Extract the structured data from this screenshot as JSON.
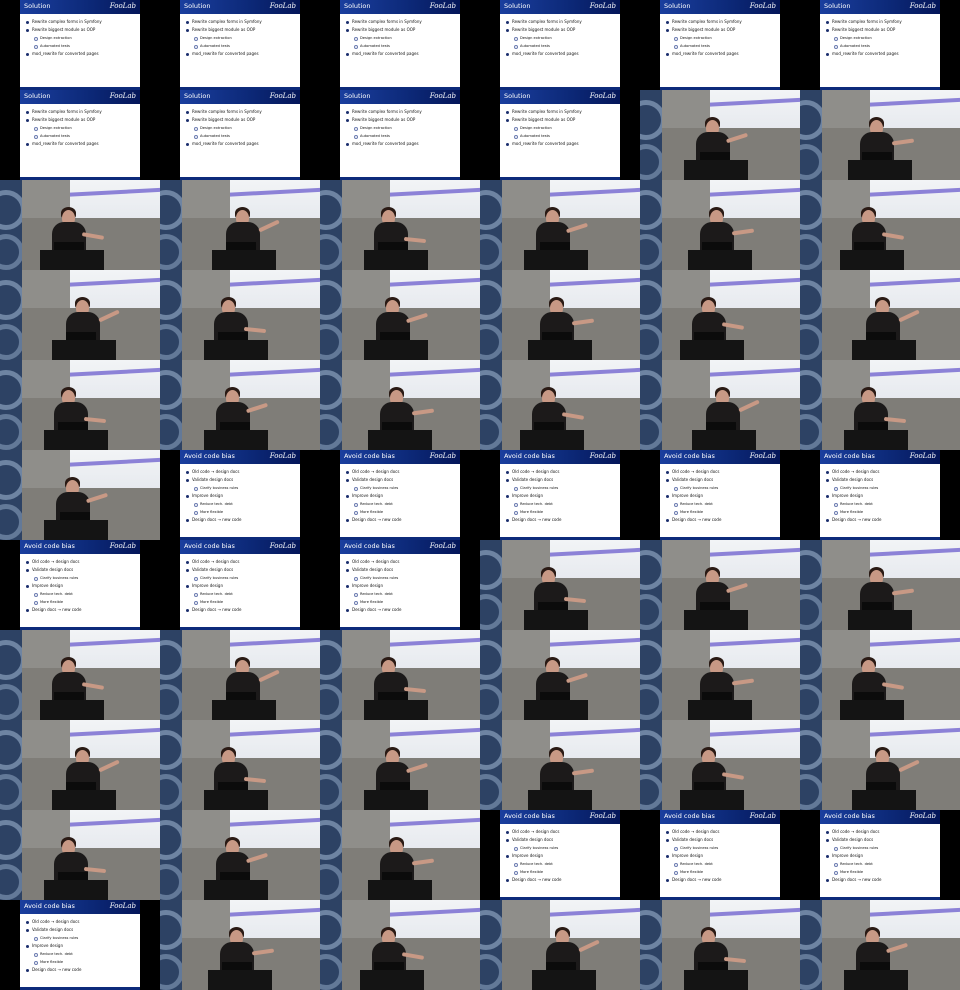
{
  "slides": {
    "solution": {
      "title": "Solution",
      "logo": "FooLab",
      "bullets": [
        {
          "text": "Rewrite complex forms in Symfony",
          "level": 1
        },
        {
          "text": "Rewrite biggest module as OOP",
          "level": 1
        },
        {
          "text": "Design extraction",
          "level": 2
        },
        {
          "text": "Automated tests",
          "level": 2
        },
        {
          "text": "mod_rewrite for converted pages",
          "level": 1
        }
      ]
    },
    "bias": {
      "title": "Avoid code bias",
      "logo": "FooLab",
      "bullets": [
        {
          "text": "Old code → design docs",
          "level": 1
        },
        {
          "text": "Validate design docs",
          "level": 1
        },
        {
          "text": "Clarify business rules",
          "level": 2
        },
        {
          "text": "Improve design",
          "level": 1
        },
        {
          "text": "Reduce tech. debt",
          "level": 2
        },
        {
          "text": "More flexible",
          "level": 2
        },
        {
          "text": "Design docs → new code",
          "level": 1
        }
      ]
    }
  },
  "frames": [
    "solution",
    "solution",
    "solution",
    "solution",
    "solution",
    "solution",
    "solution",
    "solution",
    "solution",
    "solution",
    "cam",
    "cam",
    "cam",
    "cam",
    "cam",
    "cam",
    "cam",
    "cam",
    "cam",
    "cam",
    "cam",
    "cam",
    "cam",
    "cam",
    "cam",
    "cam",
    "cam",
    "cam",
    "cam",
    "cam",
    "cam",
    "bias",
    "bias",
    "bias",
    "bias",
    "bias",
    "bias",
    "bias",
    "bias",
    "cam",
    "cam",
    "cam",
    "cam",
    "cam",
    "cam",
    "cam",
    "cam",
    "cam",
    "cam",
    "cam",
    "cam",
    "cam",
    "cam",
    "cam",
    "cam",
    "cam",
    "cam",
    "bias",
    "bias",
    "bias",
    "bias",
    "cam",
    "cam",
    "cam",
    "cam",
    "cam"
  ]
}
